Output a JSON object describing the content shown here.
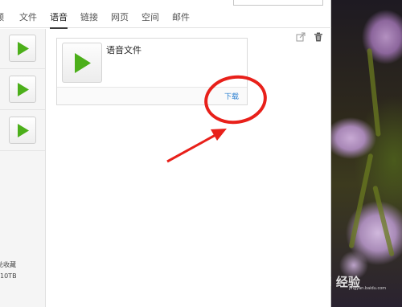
{
  "tabs": [
    {
      "label": "频"
    },
    {
      "label": "文件"
    },
    {
      "label": "语音"
    },
    {
      "label": "链接"
    },
    {
      "label": "网页"
    },
    {
      "label": "空间"
    },
    {
      "label": "邮件"
    }
  ],
  "active_tab": "语音",
  "sidebar": {
    "items": [
      {
        "icon": "play-icon"
      },
      {
        "icon": "play-icon"
      },
      {
        "icon": "play-icon"
      }
    ],
    "bottom_label": "兑收藏",
    "bottom_size": "10TB"
  },
  "content": {
    "actions": [
      {
        "icon": "share-icon"
      },
      {
        "icon": "trash-icon"
      }
    ],
    "card": {
      "title": "语音文件",
      "download_label": "下载",
      "icon": "play-icon"
    }
  },
  "watermark": {
    "text": "Bai 经验",
    "sub": "jingyan.baidu.com"
  },
  "colors": {
    "play_green": "#4caf1a",
    "link_blue": "#2a7fd0",
    "annotation_red": "#e8201a",
    "tab_underline": "#3a3a3a"
  }
}
